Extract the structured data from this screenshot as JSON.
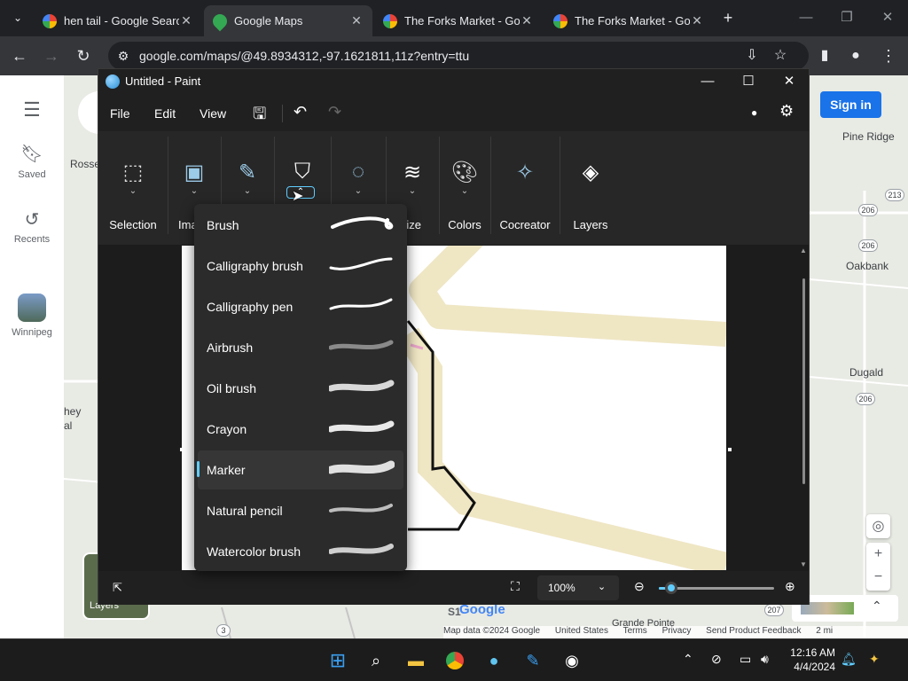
{
  "browser": {
    "tabs": [
      {
        "title": "hen tail - Google Searc",
        "favicon": "google-icon",
        "active": false
      },
      {
        "title": "Google Maps",
        "favicon": "maps-pin-icon",
        "active": true
      },
      {
        "title": "The Forks Market - Go",
        "favicon": "google-icon",
        "active": false
      },
      {
        "title": "The Forks Market - Go",
        "favicon": "google-icon",
        "active": false
      }
    ],
    "url": "google.com/maps/@49.8934312,-97.1621811,11z?entry=ttu"
  },
  "maps": {
    "rail": {
      "saved": "Saved",
      "recents": "Recents",
      "winnipeg": "Winnipeg"
    },
    "sign_in": "Sign in",
    "places": {
      "pine_ridge": "Pine Ridge",
      "oakbank": "Oakbank",
      "dugald": "Dugald",
      "rosse": "Rosse",
      "hey": "hey",
      "al": "al",
      "grande_pointe": "Grande Pointe",
      "google": "Google"
    },
    "shields": {
      "s213": "213",
      "s206a": "206",
      "s206b": "206",
      "s206c": "206",
      "s207": "207",
      "s3": "3"
    },
    "attribution": {
      "data": "Map data ©2024 Google",
      "country": "United States",
      "terms": "Terms",
      "privacy": "Privacy",
      "feedback": "Send Product Feedback",
      "scale": "2 mi"
    },
    "layers_label": "Layers"
  },
  "paint": {
    "title": "Untitled - Paint",
    "menu": {
      "file": "File",
      "edit": "Edit",
      "view": "View"
    },
    "ribbon": {
      "selection": "Selection",
      "image": "Ima",
      "size": "ize",
      "colors": "Colors",
      "cocreator": "Cocreator",
      "layers": "Layers"
    },
    "brushes": [
      {
        "name": "Brush",
        "selected": false
      },
      {
        "name": "Calligraphy brush",
        "selected": false
      },
      {
        "name": "Calligraphy pen",
        "selected": false
      },
      {
        "name": "Airbrush",
        "selected": false
      },
      {
        "name": "Oil brush",
        "selected": false
      },
      {
        "name": "Crayon",
        "selected": false
      },
      {
        "name": "Marker",
        "selected": true
      },
      {
        "name": "Natural pencil",
        "selected": false
      },
      {
        "name": "Watercolor brush",
        "selected": false
      }
    ],
    "zoom": "100%",
    "zoom_fraction": 0.05,
    "accent_color": "#60cdff"
  },
  "taskbar": {
    "time": "12:16 AM",
    "date": "4/4/2024"
  }
}
